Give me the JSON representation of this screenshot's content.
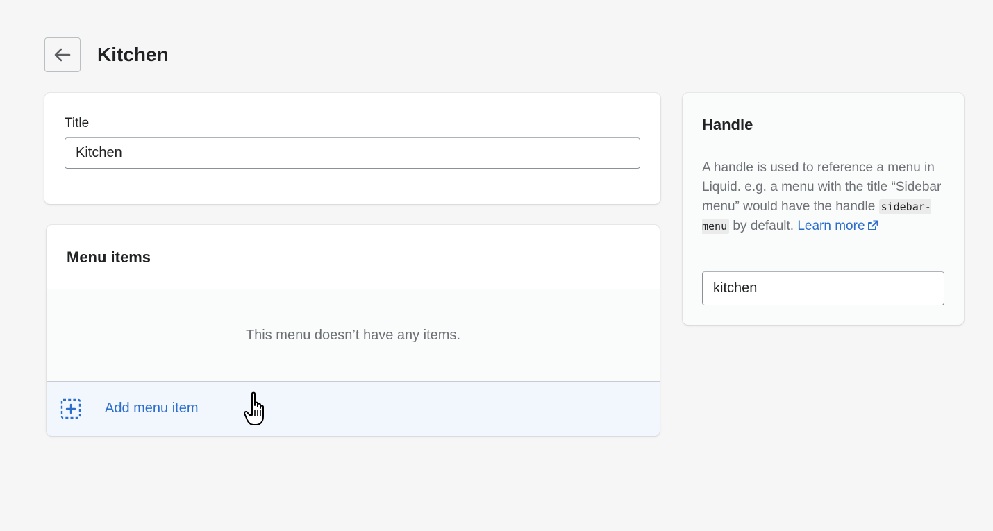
{
  "header": {
    "back_icon": "arrow-left-icon",
    "title": "Kitchen"
  },
  "title_card": {
    "label": "Title",
    "value": "Kitchen"
  },
  "menu_card": {
    "heading": "Menu items",
    "empty_message": "This menu doesn’t have any items.",
    "add_label": "Add menu item",
    "add_icon": "dashed-plus-icon"
  },
  "handle_card": {
    "heading": "Handle",
    "desc_before": "A handle is used to reference a menu in Liquid. e.g. a menu with the title “Sidebar menu” would have the handle ",
    "code": "sidebar-menu",
    "desc_after": " by default. ",
    "link_text": "Learn more",
    "link_icon": "external-link-icon",
    "value": "kitchen"
  },
  "colors": {
    "background": "#f6f6f7",
    "link": "#2c6ecb",
    "add_row_bg": "#f2f7fe",
    "text_subdued": "#6d7175"
  }
}
